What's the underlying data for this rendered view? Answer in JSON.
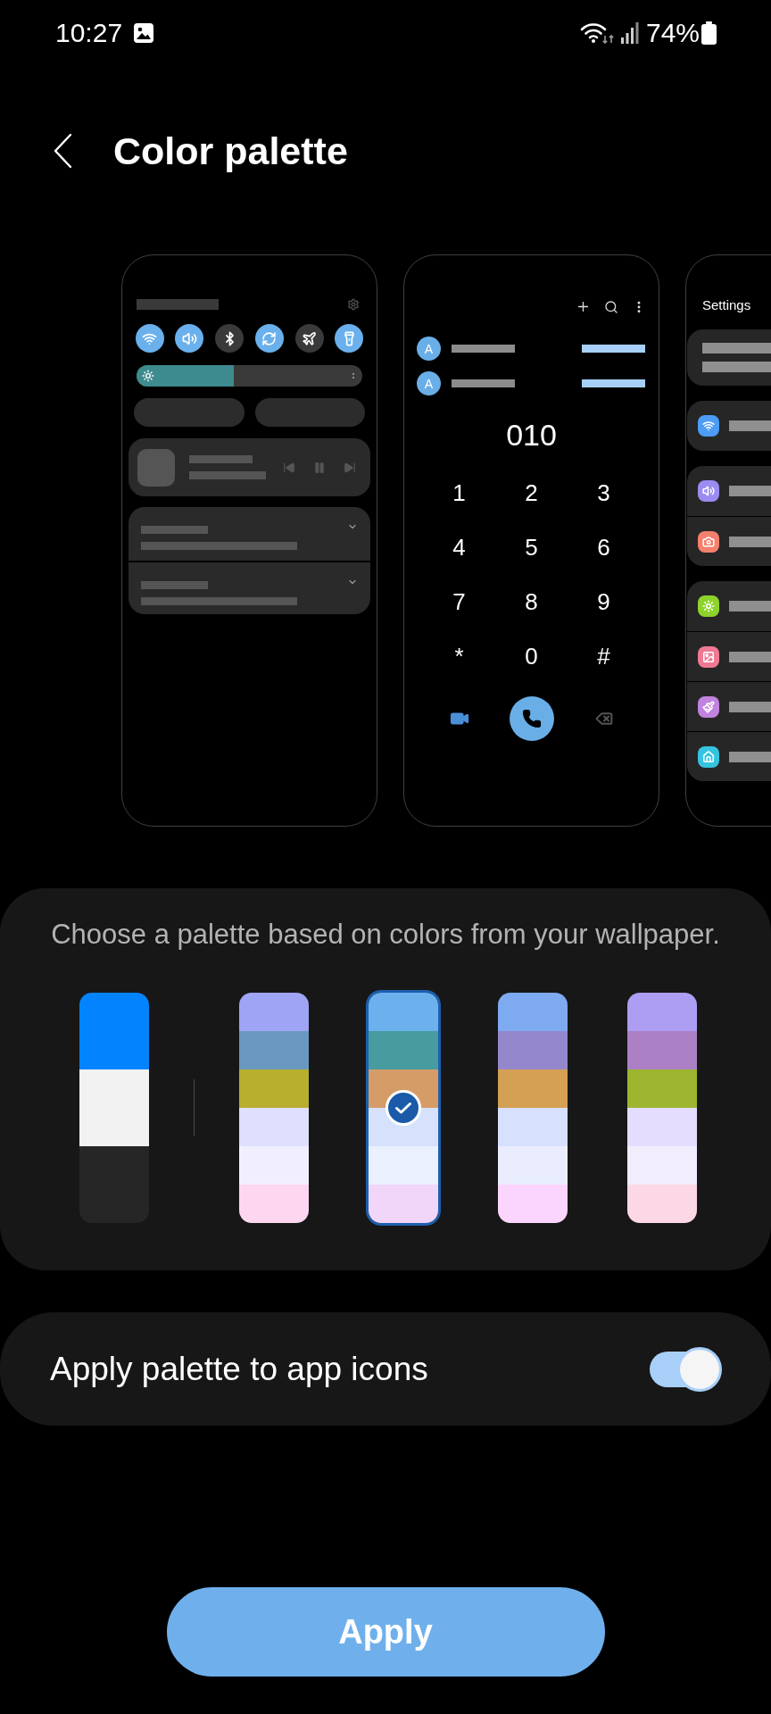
{
  "status_bar": {
    "time": "10:27",
    "battery": "74%"
  },
  "header": {
    "title": "Color palette"
  },
  "previews": [
    {
      "kind": "quick_panel",
      "toggles": [
        {
          "kind": "wifi",
          "on": true
        },
        {
          "kind": "sound",
          "on": true
        },
        {
          "kind": "bluetooth",
          "on": false
        },
        {
          "kind": "rotate",
          "on": true
        },
        {
          "kind": "airplane",
          "on": false
        },
        {
          "kind": "flashlight",
          "on": true
        }
      ],
      "brightness": {
        "level": 0.43
      }
    },
    {
      "kind": "dialer",
      "contacts": [
        {
          "initial": "A"
        },
        {
          "initial": "A"
        }
      ],
      "number": "010",
      "keys": [
        "1",
        "2",
        "3",
        "4",
        "5",
        "6",
        "7",
        "8",
        "9",
        "*",
        "0",
        "#"
      ]
    },
    {
      "kind": "settings",
      "title": "Settings",
      "groups": [
        {
          "kind": "profile"
        },
        {
          "kind": "list",
          "items": [
            {
              "kind": "wifi",
              "color": "#4d9cf6"
            }
          ]
        },
        {
          "kind": "list",
          "items": [
            {
              "kind": "sound",
              "color": "#9b8cf2"
            },
            {
              "kind": "camera",
              "color": "#f5806e"
            }
          ]
        },
        {
          "kind": "list",
          "items": [
            {
              "kind": "brightness",
              "color": "#8ed32c"
            },
            {
              "kind": "gallery",
              "color": "#ef7993"
            },
            {
              "kind": "paint",
              "color": "#c283e0"
            },
            {
              "kind": "home",
              "color": "#35c4e0"
            }
          ]
        }
      ]
    }
  ],
  "palette": {
    "description": "Choose a palette based on colors from your wallpaper.",
    "palettes": [
      {
        "kind": "basic",
        "selected": false,
        "bands": [
          {
            "color": "#0384fe"
          },
          {
            "color": "#f2f2f2"
          },
          {
            "color": "#262626"
          }
        ]
      },
      {
        "kind": "wallpaper",
        "selected": false,
        "bands": [
          {
            "color": "#a0a4f4"
          },
          {
            "color": "#6a98c0"
          },
          {
            "color": "#b8af2f"
          },
          {
            "color": "#dfdffe"
          },
          {
            "color": "#f1effe"
          },
          {
            "color": "#fdd7f0"
          }
        ]
      },
      {
        "kind": "wallpaper",
        "selected": true,
        "bands": [
          {
            "color": "#6cb0ee"
          },
          {
            "color": "#469c9f"
          },
          {
            "color": "#d59c68"
          },
          {
            "color": "#d6e2fc"
          },
          {
            "color": "#eaf0fe"
          },
          {
            "color": "#f2d6fa"
          }
        ]
      },
      {
        "kind": "wallpaper",
        "selected": false,
        "bands": [
          {
            "color": "#7eaaf1"
          },
          {
            "color": "#9487cc"
          },
          {
            "color": "#d4a054"
          },
          {
            "color": "#d7e0fd"
          },
          {
            "color": "#eaedfd"
          },
          {
            "color": "#fbd5fd"
          }
        ]
      },
      {
        "kind": "wallpaper",
        "selected": false,
        "bands": [
          {
            "color": "#ad9df3"
          },
          {
            "color": "#ab80c4"
          },
          {
            "color": "#9eb52f"
          },
          {
            "color": "#e4ddfd"
          },
          {
            "color": "#f1edfd"
          },
          {
            "color": "#fcd7e5"
          }
        ]
      }
    ]
  },
  "app_icons": {
    "label": "Apply palette to app icons",
    "on": true
  },
  "apply_button": {
    "label": "Apply"
  }
}
